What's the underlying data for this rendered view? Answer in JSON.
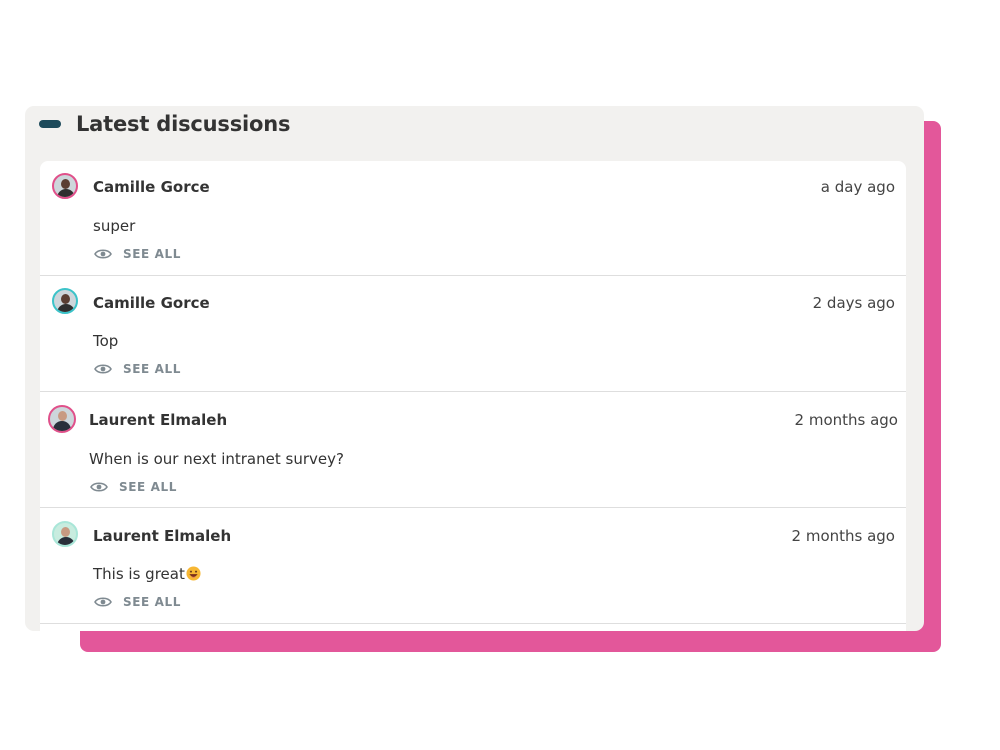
{
  "colors": {
    "accent_pink": "#e3579a",
    "header_pill": "#1d4a5a",
    "panel_bg": "#f2f1ef",
    "see_all_gray": "#7f8a91"
  },
  "widget": {
    "title": "Latest discussions",
    "collapse_icon": "minus-pill-icon"
  },
  "discussions": [
    {
      "author": "Camille Gorce",
      "time": "a day ago",
      "message": "super",
      "see_all": "SEE ALL",
      "avatar_ring": "#e0508a",
      "avatar_bg": "#d9d0c8"
    },
    {
      "author": "Camille Gorce",
      "time": "2 days ago",
      "message": "Top",
      "see_all": "SEE ALL",
      "avatar_ring": "#3cc3c9",
      "avatar_bg": "#d9d0c8"
    },
    {
      "author": "Laurent Elmaleh",
      "time": "2 months ago",
      "message": "When is our next intranet survey?",
      "see_all": "SEE ALL",
      "avatar_ring": "#e0508a",
      "avatar_bg": "#c8d6e0"
    },
    {
      "author": "Laurent Elmaleh",
      "time": "2 months ago",
      "message": "This is great",
      "emoji": "grinning-face-emoji",
      "see_all": "SEE ALL",
      "avatar_ring": "#a9e6d8",
      "avatar_bg": "#c8ecdf"
    }
  ]
}
